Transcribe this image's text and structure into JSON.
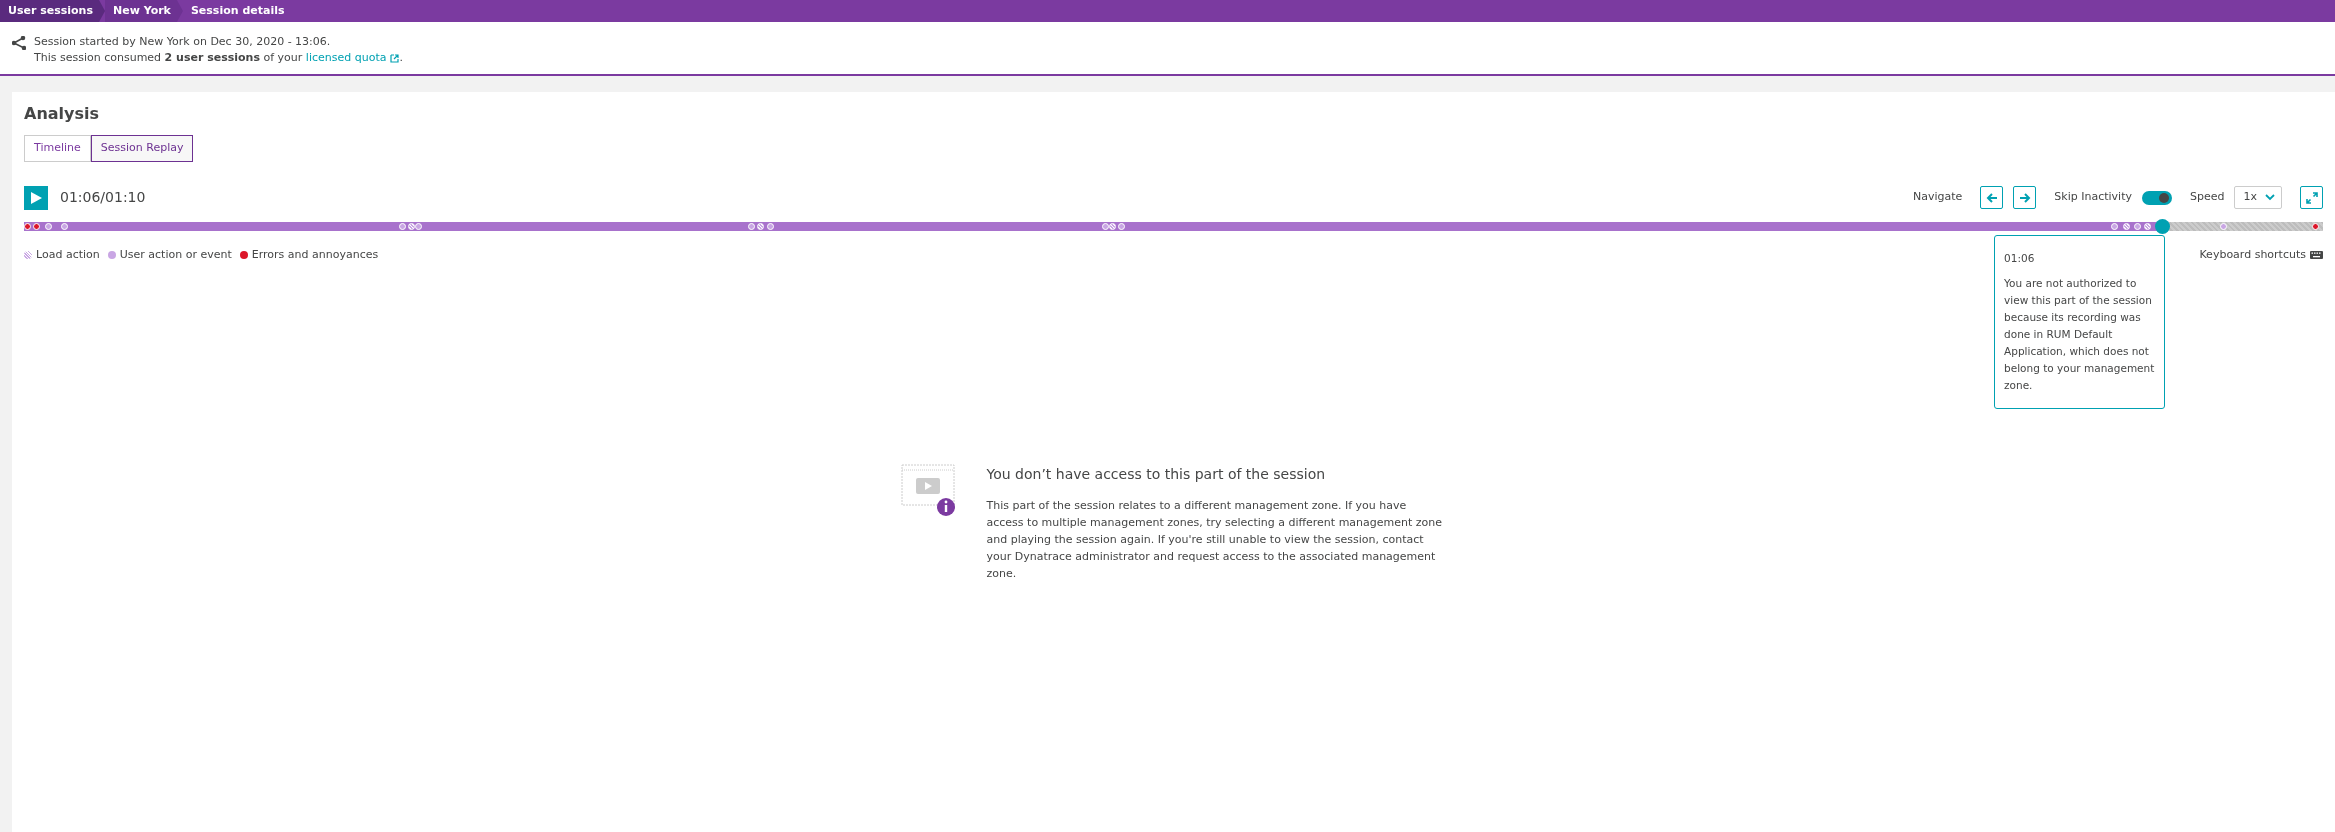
{
  "breadcrumbs": [
    {
      "label": "User sessions"
    },
    {
      "label": "New York"
    },
    {
      "label": "Session details"
    }
  ],
  "session_info": {
    "started": "Session started by New York on Dec 30, 2020 - 13:06.",
    "consumed": "This session consumed **2 user sessions** of your",
    "link": "licensed quota",
    "after_link": "."
  },
  "analysis": {
    "title": "Analysis",
    "tabs": [
      {
        "label": "Timeline",
        "selected": false
      },
      {
        "label": "Session Replay",
        "selected": true
      }
    ],
    "player": {
      "time": "01:06/01:10",
      "navigate_label": "Navigate",
      "skip_label": "Skip Inactivity",
      "skip_inactivity": true,
      "speed_label": "Speed",
      "speed": "1x",
      "level": 0.93
    },
    "legend": [
      {
        "kind": "load",
        "label": "Load action",
        "color": "#c9a6e4"
      },
      {
        "kind": "user",
        "label": "User action or event",
        "color": "#c9a6e4"
      },
      {
        "kind": "error",
        "label": "Errors and annoyances",
        "color": "#dc172a"
      }
    ],
    "keyboard_shortcuts": "Keyboard shortcuts",
    "tooltip": {
      "time": "01:06",
      "text": "You are not authorized to view this part of the session because its recording was done in RUM Default Application, which does not belong to your management zone."
    },
    "empty_state": {
      "title": "You don’t have access to this part of the session",
      "text": "This part of the session relates to a different management zone. If you have access to multiple management zones, try selecting a different management zone and playing the session again. If you're still unable to view the session, contact your Dynatrace administrator and request access to the associated management zone."
    }
  }
}
